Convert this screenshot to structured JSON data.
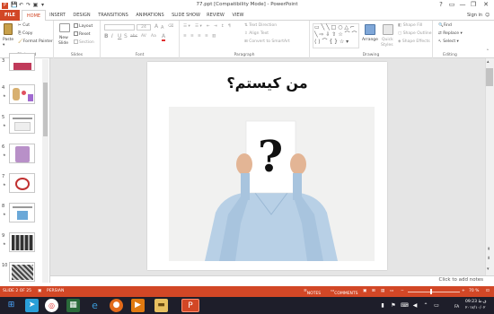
{
  "window": {
    "title": "77.ppt [Compatibility Mode] - PowerPoint",
    "help": "?",
    "restore_ribbon": "▭",
    "minimize": "—",
    "maximize": "❐",
    "close": "✕"
  },
  "qat": {
    "save": "💾",
    "undo": "↶",
    "redo": "↷",
    "present": "▣",
    "more": "▾"
  },
  "tabs": [
    "FILE",
    "HOME",
    "INSERT",
    "DESIGN",
    "TRANSITIONS",
    "ANIMATIONS",
    "SLIDE SHOW",
    "REVIEW",
    "VIEW"
  ],
  "signin": "Sign in",
  "ribbon": {
    "clipboard": {
      "paste": "Paste",
      "cut": "Cut",
      "copy": "Copy",
      "format_painter": "Format Painter",
      "label": "Clipboard"
    },
    "slides": {
      "new_slide": "New",
      "new_slide2": "Slide",
      "layout": "Layout",
      "reset": "Reset",
      "section": "Section",
      "label": "Slides"
    },
    "font": {
      "font_size": "24",
      "bold": "B",
      "italic": "I",
      "underline": "U",
      "strike": "S",
      "shadow": "abc",
      "spacing": "AV",
      "case": "Aa",
      "font_color": "A",
      "grow": "A",
      "shrink": "A",
      "label": "Font"
    },
    "paragraph": {
      "text_direction": "Text Direction",
      "align_text": "Align Text",
      "smartart": "Convert to SmartArt",
      "label": "Paragraph"
    },
    "drawing": {
      "arrange": "Arrange",
      "quick_styles": "Quick",
      "quick_styles2": "Styles",
      "shape_fill": "Shape Fill",
      "shape_outline": "Shape Outline",
      "shape_effects": "Shape Effects",
      "label": "Drawing"
    },
    "editing": {
      "find": "Find",
      "replace": "Replace",
      "select": "Select",
      "label": "Editing"
    }
  },
  "thumbnails": [
    {
      "num": "3"
    },
    {
      "num": "4"
    },
    {
      "num": "5"
    },
    {
      "num": "6"
    },
    {
      "num": "7"
    },
    {
      "num": "8"
    },
    {
      "num": "9"
    },
    {
      "num": "10"
    }
  ],
  "slide": {
    "title": "من کیستم؟"
  },
  "notes_prompt": "Click to add notes",
  "status": {
    "slide_info": "SLIDE 2 OF 25",
    "language": "PERSIAN",
    "notes": "NOTES",
    "comments": "COMMENTS",
    "zoom": "70 %",
    "accent": "#d24726"
  },
  "taskbar": {
    "time": "09:23 ق.ظ",
    "date": "۲۰۱۷/۱۰/۰۲",
    "lang": "FA"
  }
}
